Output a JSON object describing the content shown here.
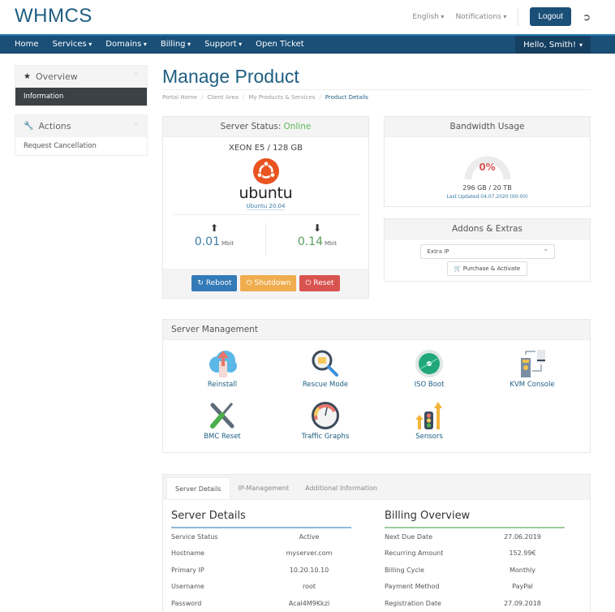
{
  "header": {
    "logo": "WHMCS",
    "language": "English",
    "notifications": "Notifications",
    "logout": "Logout"
  },
  "nav": {
    "items": [
      {
        "label": "Home",
        "dropdown": false
      },
      {
        "label": "Services",
        "dropdown": true
      },
      {
        "label": "Domains",
        "dropdown": true
      },
      {
        "label": "Billing",
        "dropdown": true
      },
      {
        "label": "Support",
        "dropdown": true
      },
      {
        "label": "Open Ticket",
        "dropdown": false
      }
    ],
    "user": "Hello, Smith!"
  },
  "sidebar": {
    "overview": {
      "title": "Overview",
      "items": [
        "Information"
      ]
    },
    "actions": {
      "title": "Actions",
      "items": [
        "Request Cancellation"
      ]
    }
  },
  "page": {
    "title": "Manage Product",
    "breadcrumb": [
      "Portal Home",
      "Client Area",
      "My Products & Services",
      "Product Details"
    ]
  },
  "server_status": {
    "label": "Server Status:",
    "status": "Online",
    "model": "XEON E5 / 128 GB",
    "os_name": "ubuntu",
    "os_version": "Ubuntu 20.04",
    "upload_value": "0.01",
    "download_value": "0.14",
    "unit": "Mbit",
    "buttons": {
      "reboot": "Reboot",
      "shutdown": "Shutdown",
      "reset": "Reset"
    }
  },
  "bandwidth": {
    "title": "Bandwidth Usage",
    "percent_label": "0%",
    "percent": 0,
    "usage": "296 GB / 20 TB",
    "last_updated": "Last Updated 04.07.2020 (00:00)"
  },
  "addons": {
    "title": "Addons & Extras",
    "selected": "Extra IP",
    "purchase": "Purchase & Activate"
  },
  "management": {
    "title": "Server Management",
    "items": [
      {
        "label": "Reinstall",
        "icon": "cloud-upload-icon"
      },
      {
        "label": "Rescue Mode",
        "icon": "magnifier-icon"
      },
      {
        "label": "ISO Boot",
        "icon": "disc-icon"
      },
      {
        "label": "KVM Console",
        "icon": "kvm-icon"
      },
      {
        "label": "BMC Reset",
        "icon": "tools-icon"
      },
      {
        "label": "Traffic Graphs",
        "icon": "speedometer-icon"
      },
      {
        "label": "Sensors",
        "icon": "traffic-light-icon"
      }
    ]
  },
  "tabs": {
    "items": [
      "Server Details",
      "IP-Management",
      "Additional Information"
    ],
    "active": 0
  },
  "server_details": {
    "title": "Server Details",
    "rows": [
      {
        "k": "Service Status",
        "v": "Active"
      },
      {
        "k": "Hostname",
        "v": "myserver.com"
      },
      {
        "k": "Primary IP",
        "v": "10.20.10.10"
      },
      {
        "k": "Username",
        "v": "root"
      },
      {
        "k": "Password",
        "v": "Acal4M9Kkzi"
      }
    ]
  },
  "billing_overview": {
    "title": "Billing Overview",
    "rows": [
      {
        "k": "Next Due Date",
        "v": "27.06.2019"
      },
      {
        "k": "Recurring Amount",
        "v": "152.99€"
      },
      {
        "k": "Billing Cycle",
        "v": "Monthly"
      },
      {
        "k": "Payment Method",
        "v": "PayPal"
      },
      {
        "k": "Registration Date",
        "v": "27.09.2018"
      }
    ]
  },
  "colors": {
    "brand": "#1a4f78",
    "online": "#5cb85c",
    "reboot": "#337ab7",
    "shutdown": "#f0ad4e",
    "reset": "#d9534f"
  }
}
